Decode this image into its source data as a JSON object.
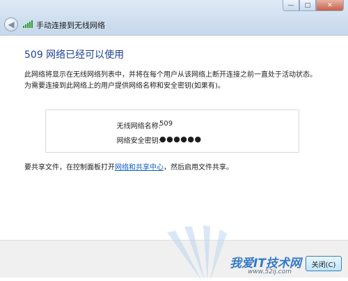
{
  "window": {
    "title": "手动连接到无线网络",
    "controls": {
      "minimize": "—",
      "maximize": "□",
      "close": "✕"
    }
  },
  "main": {
    "heading": "509 网络已经可以使用",
    "description": "此网络将显示在无线网络列表中，并将在每个用户从该网络上断开连接之前一直处于活动状态。为需要连接到此网络上的用户提供网络名称和安全密钥(如果有)。",
    "info": {
      "name_label": "无线网络名称:",
      "name_value": "509",
      "key_label": "网络安全密钥:",
      "key_value": "●●●●●●"
    },
    "share": {
      "prefix": "要共享文件，在控制面板打开",
      "link": "网络和共享中心",
      "suffix": "，然后启用文件共享。"
    }
  },
  "footer": {
    "close_button": "关闭(C)",
    "watermark_text": "我爱IT技术网",
    "watermark_url": "www.52ij.com"
  },
  "colors": {
    "heading": "#1e3f8f",
    "link": "#0c5ec7",
    "titlebar": "#cfdeef"
  }
}
